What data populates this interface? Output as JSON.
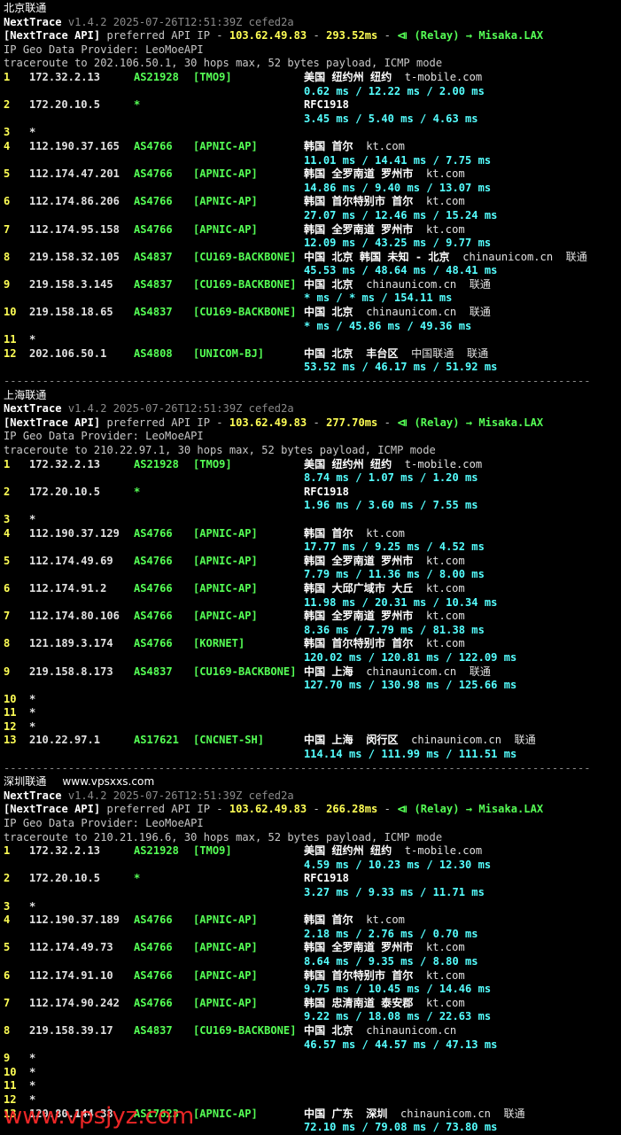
{
  "tool": "NextTrace",
  "sections": [
    {
      "title": "北京联通",
      "site_label": "",
      "header": {
        "version_line": "v1.4.2 2025-07-26T12:51:39Z cefed2a",
        "api_prefix": "[NextTrace API]",
        "api_text": " preferred API IP - ",
        "api_ip": "103.62.49.83",
        "api_ms": "293.52ms",
        "relay": "(Relay) → Misaka.LAX",
        "geo_provider": "IP Geo Data Provider: LeoMoeAPI",
        "traceroute": "traceroute to 202.106.50.1, 30 hops max, 52 bytes payload, ICMP mode"
      },
      "hops": [
        {
          "n": "1",
          "ip": "172.32.2.13",
          "asn": "AS21928",
          "tag": "[TMO9]",
          "geo": "美国 纽约州 纽约",
          "host": "t-mobile.com",
          "rtt": "0.62 ms / 12.22 ms / 2.00 ms"
        },
        {
          "n": "2",
          "ip": "172.20.10.5",
          "asn": "*",
          "tag": "",
          "geo": "RFC1918",
          "host": "",
          "rtt": "3.45 ms / 5.40 ms / 4.63 ms"
        },
        {
          "n": "3",
          "ip": "*"
        },
        {
          "n": "4",
          "ip": "112.190.37.165",
          "asn": "AS4766",
          "tag": "[APNIC-AP]",
          "geo": "韩国 首尔",
          "host": "kt.com",
          "rtt": "11.01 ms / 14.41 ms / 7.75 ms"
        },
        {
          "n": "5",
          "ip": "112.174.47.201",
          "asn": "AS4766",
          "tag": "[APNIC-AP]",
          "geo": "韩国 全罗南道 罗州市",
          "host": "kt.com",
          "rtt": "14.86 ms / 9.40 ms / 13.07 ms"
        },
        {
          "n": "6",
          "ip": "112.174.86.206",
          "asn": "AS4766",
          "tag": "[APNIC-AP]",
          "geo": "韩国 首尔特别市 首尔",
          "host": "kt.com",
          "rtt": "27.07 ms / 12.46 ms / 15.24 ms"
        },
        {
          "n": "7",
          "ip": "112.174.95.158",
          "asn": "AS4766",
          "tag": "[APNIC-AP]",
          "geo": "韩国 全罗南道 罗州市",
          "host": "kt.com",
          "rtt": "12.09 ms / 43.25 ms / 9.77 ms"
        },
        {
          "n": "8",
          "ip": "219.158.32.105",
          "asn": "AS4837",
          "tag": "[CU169-BACKBONE]",
          "geo": "中国 北京 韩国 未知 - 北京",
          "host": "chinaunicom.cn  联通",
          "rtt": "45.53 ms / 48.64 ms / 48.41 ms"
        },
        {
          "n": "9",
          "ip": "219.158.3.145",
          "asn": "AS4837",
          "tag": "[CU169-BACKBONE]",
          "geo": "中国 北京",
          "host": "chinaunicom.cn  联通",
          "rtt": "* ms / * ms / 154.11 ms"
        },
        {
          "n": "10",
          "ip": "219.158.18.65",
          "asn": "AS4837",
          "tag": "[CU169-BACKBONE]",
          "geo": "中国 北京",
          "host": "chinaunicom.cn  联通",
          "rtt": "* ms / 45.86 ms / 49.36 ms"
        },
        {
          "n": "11",
          "ip": "*"
        },
        {
          "n": "12",
          "ip": "202.106.50.1",
          "asn": "AS4808",
          "tag": "[UNICOM-BJ]",
          "geo": "中国 北京  丰台区",
          "host": "中国联通  联通",
          "rtt": "53.52 ms / 46.17 ms / 51.92 ms"
        }
      ]
    },
    {
      "title": "上海联通",
      "site_label": "",
      "header": {
        "version_line": "v1.4.2 2025-07-26T12:51:39Z cefed2a",
        "api_prefix": "[NextTrace API]",
        "api_text": " preferred API IP - ",
        "api_ip": "103.62.49.83",
        "api_ms": "277.70ms",
        "relay": "(Relay) → Misaka.LAX",
        "geo_provider": "IP Geo Data Provider: LeoMoeAPI",
        "traceroute": "traceroute to 210.22.97.1, 30 hops max, 52 bytes payload, ICMP mode"
      },
      "hops": [
        {
          "n": "1",
          "ip": "172.32.2.13",
          "asn": "AS21928",
          "tag": "[TMO9]",
          "geo": "美国 纽约州 纽约",
          "host": "t-mobile.com",
          "rtt": "8.74 ms / 1.07 ms / 1.20 ms"
        },
        {
          "n": "2",
          "ip": "172.20.10.5",
          "asn": "*",
          "tag": "",
          "geo": "RFC1918",
          "host": "",
          "rtt": "1.96 ms / 3.60 ms / 7.55 ms"
        },
        {
          "n": "3",
          "ip": "*"
        },
        {
          "n": "4",
          "ip": "112.190.37.129",
          "asn": "AS4766",
          "tag": "[APNIC-AP]",
          "geo": "韩国 首尔",
          "host": "kt.com",
          "rtt": "17.77 ms / 9.25 ms / 4.52 ms"
        },
        {
          "n": "5",
          "ip": "112.174.49.69",
          "asn": "AS4766",
          "tag": "[APNIC-AP]",
          "geo": "韩国 全罗南道 罗州市",
          "host": "kt.com",
          "rtt": "7.79 ms / 11.36 ms / 8.00 ms"
        },
        {
          "n": "6",
          "ip": "112.174.91.2",
          "asn": "AS4766",
          "tag": "[APNIC-AP]",
          "geo": "韩国 大邱广域市 大丘",
          "host": "kt.com",
          "rtt": "11.98 ms / 20.31 ms / 10.34 ms"
        },
        {
          "n": "7",
          "ip": "112.174.80.106",
          "asn": "AS4766",
          "tag": "[APNIC-AP]",
          "geo": "韩国 全罗南道 罗州市",
          "host": "kt.com",
          "rtt": "8.36 ms / 7.79 ms / 81.38 ms"
        },
        {
          "n": "8",
          "ip": "121.189.3.174",
          "asn": "AS4766",
          "tag": "[KORNET]",
          "geo": "韩国 首尔特别市 首尔",
          "host": "kt.com",
          "rtt": "120.02 ms / 120.81 ms / 122.09 ms"
        },
        {
          "n": "9",
          "ip": "219.158.8.173",
          "asn": "AS4837",
          "tag": "[CU169-BACKBONE]",
          "geo": "中国 上海",
          "host": "chinaunicom.cn  联通",
          "rtt": "127.70 ms / 130.98 ms / 125.66 ms"
        },
        {
          "n": "10",
          "ip": "*"
        },
        {
          "n": "11",
          "ip": "*"
        },
        {
          "n": "12",
          "ip": "*"
        },
        {
          "n": "13",
          "ip": "210.22.97.1",
          "asn": "AS17621",
          "tag": "[CNCNET-SH]",
          "geo": "中国 上海  闵行区",
          "host": "chinaunicom.cn  联通",
          "rtt": "114.14 ms / 111.99 ms / 111.51 ms"
        }
      ]
    },
    {
      "title": "深圳联通",
      "site_label": "www.vpsxxs.com",
      "header": {
        "version_line": "v1.4.2 2025-07-26T12:51:39Z cefed2a",
        "api_prefix": "[NextTrace API]",
        "api_text": " preferred API IP - ",
        "api_ip": "103.62.49.83",
        "api_ms": "266.28ms",
        "relay": "(Relay) → Misaka.LAX",
        "geo_provider": "IP Geo Data Provider: LeoMoeAPI",
        "traceroute": "traceroute to 210.21.196.6, 30 hops max, 52 bytes payload, ICMP mode"
      },
      "hops": [
        {
          "n": "1",
          "ip": "172.32.2.13",
          "asn": "AS21928",
          "tag": "[TMO9]",
          "geo": "美国 纽约州 纽约",
          "host": "t-mobile.com",
          "rtt": "4.59 ms / 10.23 ms / 12.30 ms"
        },
        {
          "n": "2",
          "ip": "172.20.10.5",
          "asn": "*",
          "tag": "",
          "geo": "RFC1918",
          "host": "",
          "rtt": "3.27 ms / 9.33 ms / 11.71 ms"
        },
        {
          "n": "3",
          "ip": "*"
        },
        {
          "n": "4",
          "ip": "112.190.37.189",
          "asn": "AS4766",
          "tag": "[APNIC-AP]",
          "geo": "韩国 首尔",
          "host": "kt.com",
          "rtt": "2.18 ms / 2.76 ms / 0.70 ms"
        },
        {
          "n": "5",
          "ip": "112.174.49.73",
          "asn": "AS4766",
          "tag": "[APNIC-AP]",
          "geo": "韩国 全罗南道 罗州市",
          "host": "kt.com",
          "rtt": "8.64 ms / 9.35 ms / 8.80 ms"
        },
        {
          "n": "6",
          "ip": "112.174.91.10",
          "asn": "AS4766",
          "tag": "[APNIC-AP]",
          "geo": "韩国 首尔特别市 首尔",
          "host": "kt.com",
          "rtt": "9.75 ms / 10.45 ms / 14.46 ms"
        },
        {
          "n": "7",
          "ip": "112.174.90.242",
          "asn": "AS4766",
          "tag": "[APNIC-AP]",
          "geo": "韩国 忠清南道 泰安郡",
          "host": "kt.com",
          "rtt": "9.22 ms / 18.08 ms / 22.63 ms"
        },
        {
          "n": "8",
          "ip": "219.158.39.17",
          "asn": "AS4837",
          "tag": "[CU169-BACKBONE]",
          "geo": "中国 北京",
          "host": "chinaunicom.cn",
          "rtt": "46.57 ms / 44.57 ms / 47.13 ms"
        },
        {
          "n": "9",
          "ip": "*"
        },
        {
          "n": "10",
          "ip": "*"
        },
        {
          "n": "11",
          "ip": "*"
        },
        {
          "n": "12",
          "ip": "*"
        },
        {
          "n": "13",
          "ip": "120.80.144.38",
          "asn": "AS17623",
          "tag": "[APNIC-AP]",
          "geo": "中国 广东  深圳",
          "host": "chinaunicom.cn  联通",
          "rtt": "72.10 ms / 79.08 ms / 73.80 ms"
        }
      ]
    }
  ],
  "separator": "-------------------------------------------------------------------------------------------",
  "watermark": "www.vpsjyz.com"
}
